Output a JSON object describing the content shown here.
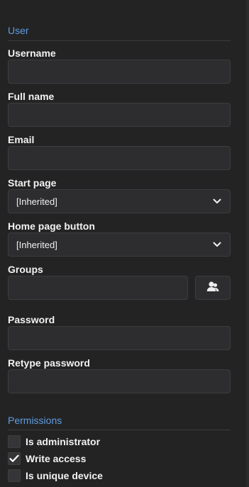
{
  "user_section": {
    "title": "User"
  },
  "fields": {
    "username": {
      "label": "Username",
      "value": ""
    },
    "full_name": {
      "label": "Full name",
      "value": ""
    },
    "email": {
      "label": "Email",
      "value": ""
    },
    "start_page": {
      "label": "Start page",
      "selected": "[Inherited]"
    },
    "home_page_button": {
      "label": "Home page button",
      "selected": "[Inherited]"
    },
    "groups": {
      "label": "Groups",
      "value": "",
      "button_icon": "user-group-icon"
    },
    "password": {
      "label": "Password",
      "value": ""
    },
    "retype_password": {
      "label": "Retype password",
      "value": ""
    }
  },
  "permissions_section": {
    "title": "Permissions",
    "items": [
      {
        "label": "Is administrator",
        "checked": false
      },
      {
        "label": "Write access",
        "checked": true
      },
      {
        "label": "Is unique device",
        "checked": false
      }
    ]
  },
  "colors": {
    "accent": "#5f9de0",
    "panel_bg": "#232324",
    "field_bg": "#2d2d30"
  }
}
